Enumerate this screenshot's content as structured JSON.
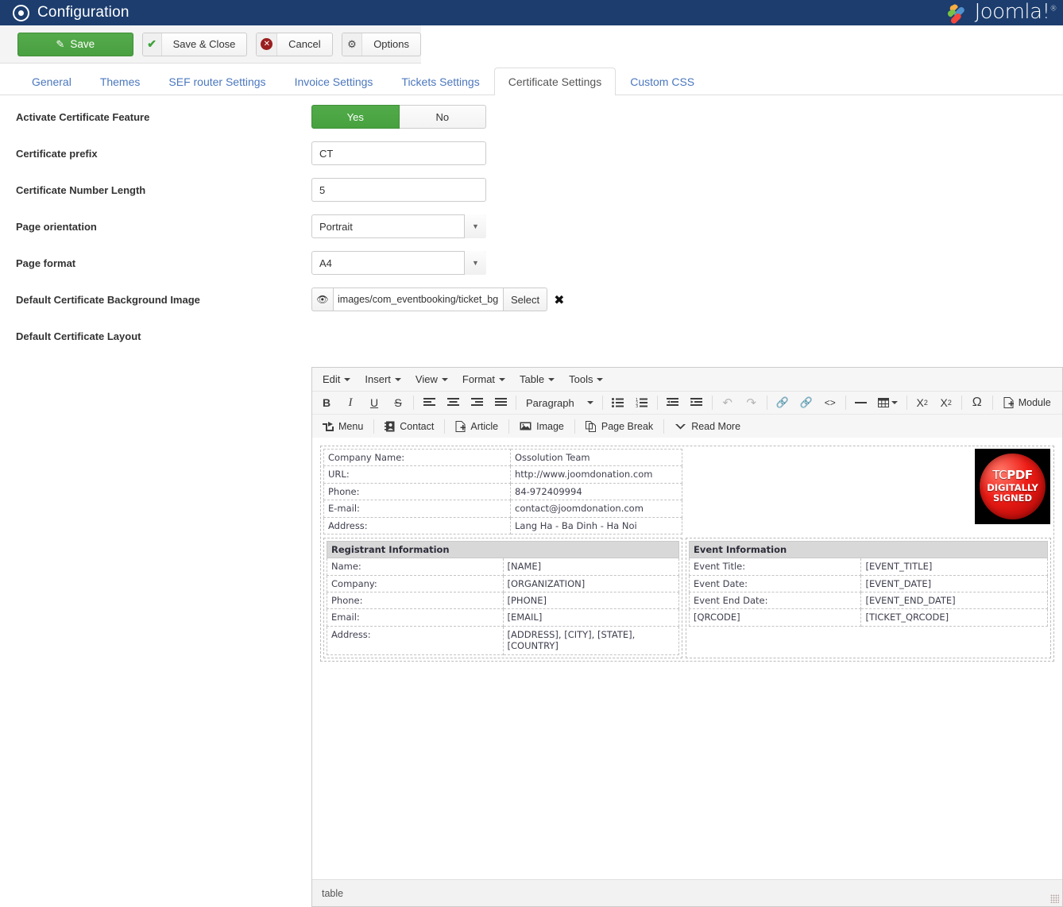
{
  "header": {
    "title": "Configuration",
    "title_icon": "target-circle-icon",
    "brand": "Joomla!",
    "brand_reg": "®"
  },
  "toolbar": {
    "save_label": "Save",
    "save_close_label": "Save & Close",
    "cancel_label": "Cancel",
    "options_label": "Options"
  },
  "tabs": [
    {
      "label": "General",
      "active": false
    },
    {
      "label": "Themes",
      "active": false
    },
    {
      "label": "SEF router Settings",
      "active": false
    },
    {
      "label": "Invoice Settings",
      "active": false
    },
    {
      "label": "Tickets Settings",
      "active": false
    },
    {
      "label": "Certificate Settings",
      "active": true
    },
    {
      "label": "Custom CSS",
      "active": false
    }
  ],
  "form": {
    "activate": {
      "label": "Activate Certificate Feature",
      "yes": "Yes",
      "no": "No",
      "selected": "Yes"
    },
    "prefix": {
      "label": "Certificate prefix",
      "value": "CT"
    },
    "number_length": {
      "label": "Certificate Number Length",
      "value": "5"
    },
    "orientation": {
      "label": "Page orientation",
      "value": "Portrait"
    },
    "page_format": {
      "label": "Page format",
      "value": "A4"
    },
    "background_image": {
      "label": "Default Certificate Background Image",
      "value": "images/com_eventbooking/ticket_bg",
      "select_label": "Select"
    },
    "layout": {
      "label": "Default Certificate Layout"
    }
  },
  "editor": {
    "menubar": [
      "Edit",
      "Insert",
      "View",
      "Format",
      "Table",
      "Tools"
    ],
    "format_select": "Paragraph",
    "joomla_buttons": [
      {
        "label": "Menu",
        "icon": "menu-share-icon"
      },
      {
        "label": "Contact",
        "icon": "contact-card-icon"
      },
      {
        "label": "Article",
        "icon": "article-page-icon"
      },
      {
        "label": "Image",
        "icon": "image-icon"
      },
      {
        "label": "Page Break",
        "icon": "page-break-icon"
      },
      {
        "label": "Read More",
        "icon": "read-more-chevron-icon"
      }
    ],
    "module_button": "Module",
    "statusbar_path": "table"
  },
  "certificate": {
    "company": [
      {
        "label": "Company Name:",
        "value": "Ossolution Team"
      },
      {
        "label": "URL:",
        "value": "http://www.joomdonation.com"
      },
      {
        "label": "Phone:",
        "value": "84-972409994"
      },
      {
        "label": "E-mail:",
        "value": "contact@joomdonation.com"
      },
      {
        "label": "Address:",
        "value": "Lang Ha - Ba Dinh - Ha Noi"
      }
    ],
    "seal": {
      "line1_a": "TC",
      "line1_b": "PDF",
      "line2": "DIGITALLY",
      "line3": "SIGNED"
    },
    "registrant": {
      "heading": "Registrant Information",
      "rows": [
        {
          "label": "Name:",
          "value": "[NAME]"
        },
        {
          "label": "Company:",
          "value": "[ORGANIZATION]"
        },
        {
          "label": "Phone:",
          "value": "[PHONE]"
        },
        {
          "label": "Email:",
          "value": "[EMAIL]"
        },
        {
          "label": "Address:",
          "value": "[ADDRESS], [CITY], [STATE], [COUNTRY]"
        }
      ]
    },
    "event": {
      "heading": "Event Information",
      "rows": [
        {
          "label": "Event Title:",
          "value": "[EVENT_TITLE]"
        },
        {
          "label": "Event Date:",
          "value": "[EVENT_DATE]"
        },
        {
          "label": "Event End Date:",
          "value": "[EVENT_END_DATE]"
        },
        {
          "label": "[QRCODE]",
          "value": "[TICKET_QRCODE]"
        }
      ]
    }
  },
  "colors": {
    "header_bg": "#1c3d6e",
    "accent_green": "#4aa341",
    "tab_link": "#4b77be",
    "cancel_red": "#9b1f1f"
  }
}
